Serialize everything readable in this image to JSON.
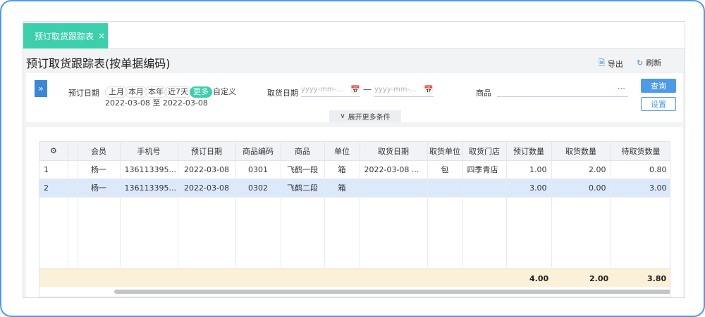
{
  "tab": {
    "label": "预订取货跟踪表",
    "close": "×"
  },
  "page": {
    "title": "预订取货跟踪表(按单据编码)"
  },
  "toolbar": {
    "export_label": "导出",
    "refresh_label": "刷新"
  },
  "filter": {
    "order_date_label": "预订日期",
    "quick_dates": [
      "上月",
      "本月",
      "本年",
      "近7天",
      "更多",
      "自定义"
    ],
    "active_quick_date": "更多",
    "order_date_range": "2022-03-08 至 2022-03-08",
    "pickup_date_label": "取货日期",
    "date_placeholder": "yyyy-mm-...",
    "range_dash": "—",
    "goods_label": "商品",
    "goods_more": "···",
    "query_label": "查询",
    "settings_label": "设置",
    "expand_label": "展开更多条件"
  },
  "table": {
    "columns": [
      "会员",
      "手机号",
      "预订日期",
      "商品编码",
      "商品",
      "单位",
      "取货日期",
      "取货单位",
      "取货门店",
      "预订数量",
      "取货数量",
      "待取货数量"
    ],
    "rows": [
      {
        "index": "1",
        "member": "杨一",
        "phone": "136113395...",
        "order_date": "2022-03-08",
        "code": "0301",
        "goods": "飞鹤一段",
        "unit": "箱",
        "pickup_date": "2022-03-08 ...",
        "pickup_unit": "包",
        "store": "四季青店",
        "order_qty": "1.00",
        "pickup_qty": "2.00",
        "pending_qty": "0.80"
      },
      {
        "index": "2",
        "member": "杨一",
        "phone": "136113395...",
        "order_date": "2022-03-08",
        "code": "0302",
        "goods": "飞鹤二段",
        "unit": "箱",
        "pickup_date": "",
        "pickup_unit": "",
        "store": "",
        "order_qty": "3.00",
        "pickup_qty": "0.00",
        "pending_qty": "3.00"
      }
    ],
    "totals": {
      "order_qty": "4.00",
      "pickup_qty": "2.00",
      "pending_qty": "3.80"
    }
  },
  "colors": {
    "accent": "#3ccfac",
    "primary": "#4d9be8",
    "selected_row": "#dbe9fb",
    "total_row": "#fbf1d9"
  }
}
